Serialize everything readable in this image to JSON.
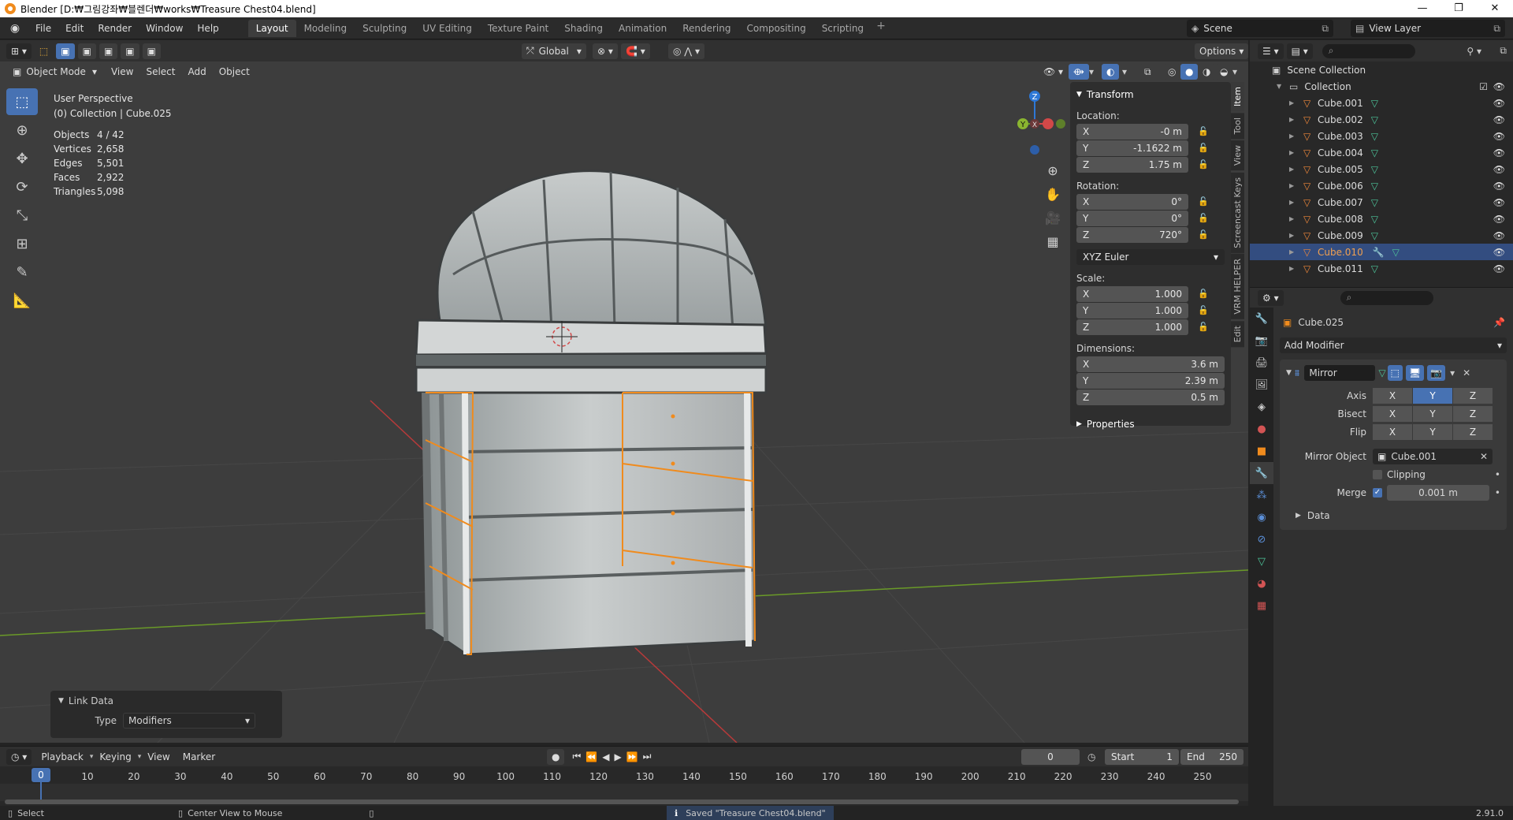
{
  "window": {
    "title": "Blender [D:₩그림강좌₩블렌더₩works₩Treasure Chest04.blend]",
    "minimize": "—",
    "maximize": "❐",
    "close": "✕"
  },
  "menu": [
    "File",
    "Edit",
    "Render",
    "Window",
    "Help"
  ],
  "workspaces": [
    "Layout",
    "Modeling",
    "Sculpting",
    "UV Editing",
    "Texture Paint",
    "Shading",
    "Animation",
    "Rendering",
    "Compositing",
    "Scripting"
  ],
  "active_workspace": "Layout",
  "scene": {
    "name": "Scene",
    "view_layer": "View Layer"
  },
  "viewport_header": {
    "transform_orientation": "Global",
    "options_label": "Options",
    "mode": "Object Mode",
    "menus": [
      "View",
      "Select",
      "Add",
      "Object"
    ]
  },
  "viewport": {
    "perspective": "User Perspective",
    "collection_line": "(0) Collection | Cube.025",
    "stats": [
      {
        "key": "Objects",
        "value": "4 / 42"
      },
      {
        "key": "Vertices",
        "value": "2,658"
      },
      {
        "key": "Edges",
        "value": "5,501"
      },
      {
        "key": "Faces",
        "value": "2,922"
      },
      {
        "key": "Triangles",
        "value": "5,098"
      }
    ],
    "gizmo": {
      "x": "X",
      "y": "Y",
      "z": "Z"
    }
  },
  "npanel": {
    "transform_title": "Transform",
    "location_label": "Location:",
    "location": {
      "x": "-0 m",
      "y": "-1.1622 m",
      "z": "1.75 m"
    },
    "rotation_label": "Rotation:",
    "rotation": {
      "x": "0°",
      "y": "0°",
      "z": "720°"
    },
    "rotation_mode": "XYZ Euler",
    "scale_label": "Scale:",
    "scale": {
      "x": "1.000",
      "y": "1.000",
      "z": "1.000"
    },
    "dimensions_label": "Dimensions:",
    "dimensions": {
      "x": "3.6 m",
      "y": "2.39 m",
      "z": "0.5 m"
    },
    "properties_title": "Properties",
    "axis_x": "X",
    "axis_y": "Y",
    "axis_z": "Z",
    "tabs": [
      "Item",
      "Tool",
      "View",
      "Screencast Keys",
      "VRM HELPER",
      "Edit"
    ]
  },
  "link_data": {
    "title": "Link Data",
    "type_label": "Type",
    "type_value": "Modifiers"
  },
  "timeline": {
    "menus": [
      "Playback",
      "Keying",
      "View",
      "Marker"
    ],
    "current_frame": "0",
    "start_label": "Start",
    "start": "1",
    "end_label": "End",
    "end": "250",
    "ticks": [
      "0",
      "10",
      "20",
      "30",
      "40",
      "50",
      "60",
      "70",
      "80",
      "90",
      "100",
      "110",
      "120",
      "130",
      "140",
      "150",
      "160",
      "170",
      "180",
      "190",
      "200",
      "210",
      "220",
      "230",
      "240",
      "250"
    ],
    "playhead_frame": 0,
    "frame_end": 250
  },
  "statusbar": {
    "select": "Select",
    "center_view": "Center View to Mouse",
    "saved_message": "Saved \"Treasure Chest04.blend\"",
    "version": "2.91.0"
  },
  "outliner": {
    "scene_collection": "Scene Collection",
    "collection": "Collection",
    "items": [
      "Cube.001",
      "Cube.002",
      "Cube.003",
      "Cube.004",
      "Cube.005",
      "Cube.006",
      "Cube.007",
      "Cube.008",
      "Cube.009",
      "Cube.010",
      "Cube.011"
    ],
    "selected_item": "Cube.010"
  },
  "properties": {
    "object_name": "Cube.025",
    "add_modifier": "Add Modifier",
    "modifier_name": "Mirror",
    "axis_label": "Axis",
    "bisect_label": "Bisect",
    "flip_label": "Flip",
    "mirror_object_label": "Mirror Object",
    "mirror_object": "Cube.001",
    "clipping_label": "Clipping",
    "merge_label": "Merge",
    "merge_value": "0.001 m",
    "data_label": "Data"
  },
  "colors": {
    "accent": "#4772b3",
    "selected_orange": "#f08b1d",
    "grid_x": "#b83a3a",
    "grid_y": "#6a9a28"
  }
}
